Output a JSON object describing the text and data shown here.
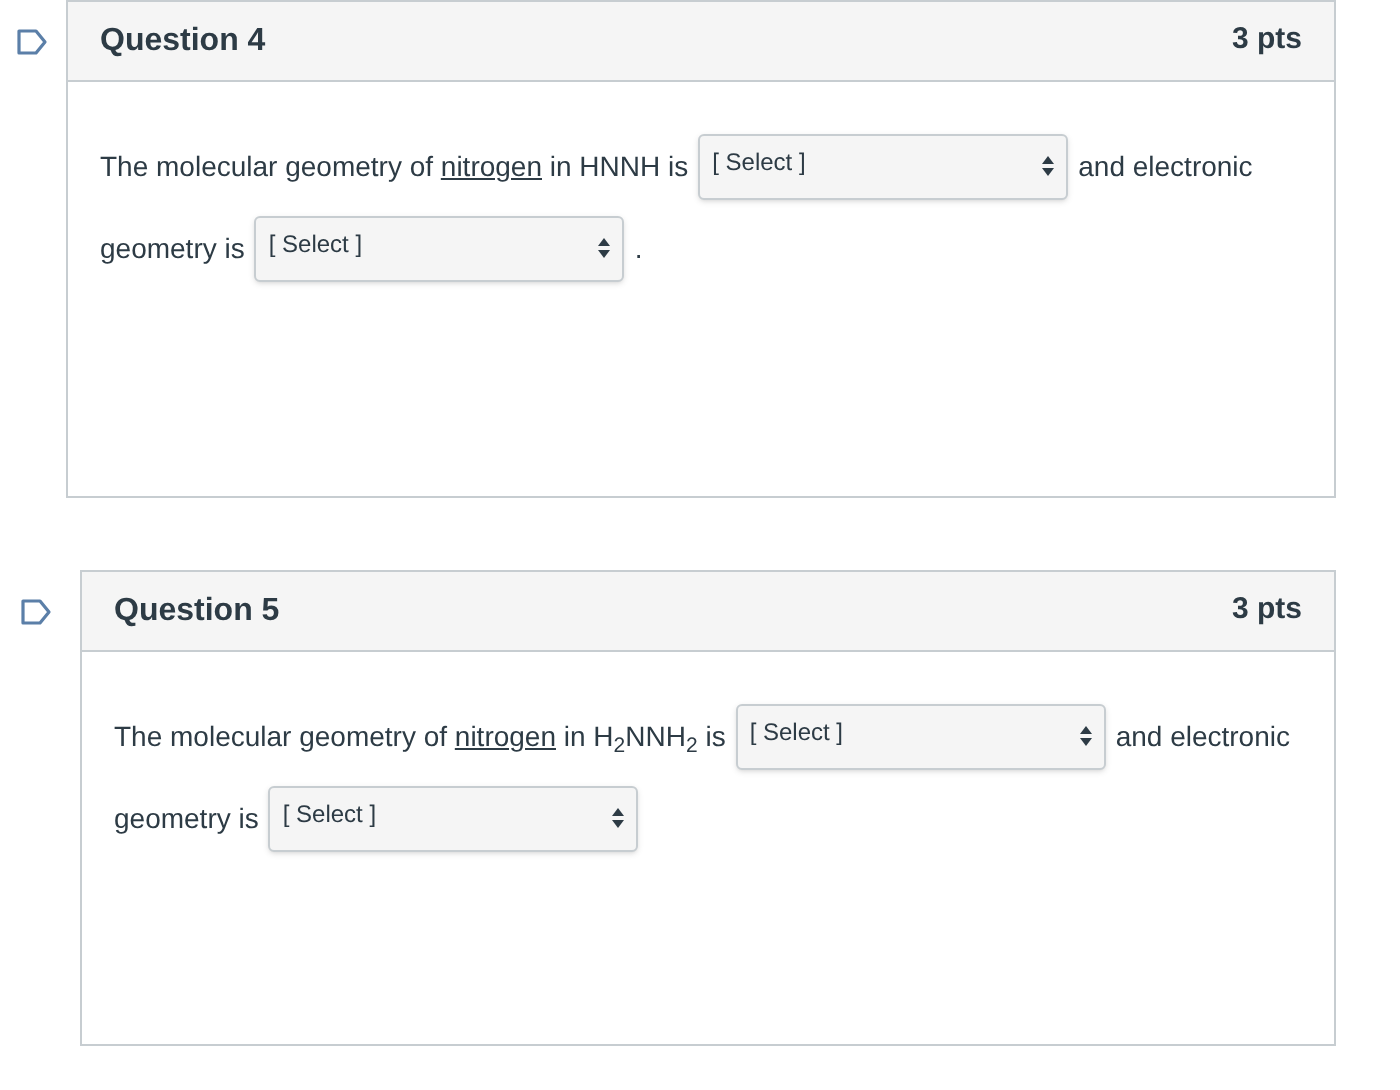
{
  "questions": [
    {
      "title": "Question 4",
      "points": "3 pts",
      "lines": [
        [
          {
            "kind": "text",
            "text": "The molecular geometry of "
          },
          {
            "kind": "term",
            "text": "nitrogen"
          },
          {
            "kind": "text",
            "text": " in HNNH is"
          },
          {
            "kind": "select",
            "placeholder": "[ Select ]"
          },
          {
            "kind": "text",
            "text": "and electronic"
          }
        ],
        [
          {
            "kind": "text",
            "text": "geometry is"
          },
          {
            "kind": "select",
            "placeholder": "[ Select ]"
          },
          {
            "kind": "text",
            "text": "."
          }
        ]
      ]
    },
    {
      "title": "Question 5",
      "points": "3 pts",
      "lines": [
        [
          {
            "kind": "text",
            "text": "The molecular geometry of "
          },
          {
            "kind": "term",
            "text": "nitrogen"
          },
          {
            "kind": "text",
            "text": " in H$_{2}$NNH$_{2}$ is"
          },
          {
            "kind": "select",
            "placeholder": "[ Select ]"
          },
          {
            "kind": "text",
            "text": "and electronic"
          }
        ],
        [
          {
            "kind": "text",
            "text": "geometry is"
          },
          {
            "kind": "select",
            "placeholder": "[ Select ]"
          }
        ]
      ]
    }
  ]
}
